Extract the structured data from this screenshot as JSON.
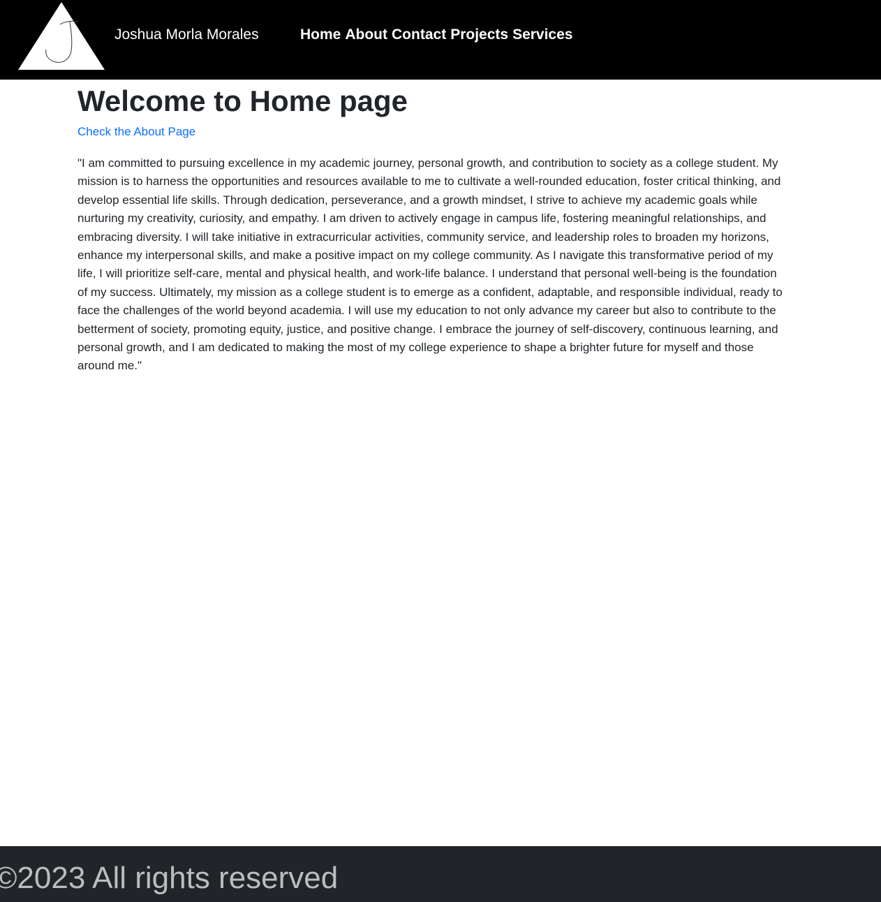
{
  "header": {
    "logo_icon": "hand-drawn-j-triangle-logo",
    "brand_name": "Joshua Morla Morales",
    "nav": [
      {
        "label": "Home"
      },
      {
        "label": "About"
      },
      {
        "label": "Contact"
      },
      {
        "label": "Projects"
      },
      {
        "label": "Services"
      }
    ]
  },
  "main": {
    "title": "Welcome to Home page",
    "about_link": "Check the About Page",
    "mission_text": "\"I am committed to pursuing excellence in my academic journey, personal growth, and contribution to society as a college student. My mission is to harness the opportunities and resources available to me to cultivate a well-rounded education, foster critical thinking, and develop essential life skills. Through dedication, perseverance, and a growth mindset, I strive to achieve my academic goals while nurturing my creativity, curiosity, and empathy. I am driven to actively engage in campus life, fostering meaningful relationships, and embracing diversity. I will take initiative in extracurricular activities, community service, and leadership roles to broaden my horizons, enhance my interpersonal skills, and make a positive impact on my college community. As I navigate this transformative period of my life, I will prioritize self-care, mental and physical health, and work-life balance. I understand that personal well-being is the foundation of my success. Ultimately, my mission as a college student is to emerge as a confident, adaptable, and responsible individual, ready to face the challenges of the world beyond academia. I will use my education to not only advance my career but also to contribute to the betterment of society, promoting equity, justice, and positive change. I embrace the journey of self-discovery, continuous learning, and personal growth, and I am dedicated to making the most of my college experience to shape a brighter future for myself and those around me.\""
  },
  "footer": {
    "copyright": "©2023 All rights reserved"
  },
  "colors": {
    "header_bg": "#000000",
    "link": "#0d6efd",
    "text": "#212529",
    "footer_bg": "#212529",
    "footer_text": "#bdbdbd"
  }
}
